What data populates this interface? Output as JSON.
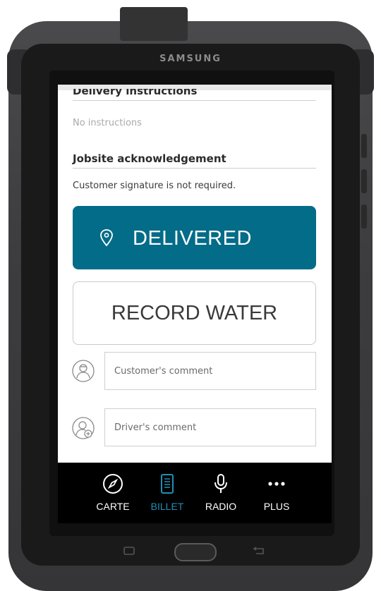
{
  "device": {
    "brand": "SAMSUNG"
  },
  "status_bar": {
    "left": "",
    "right": ""
  },
  "sections": {
    "delivery_instructions": {
      "heading": "Delivery instructions",
      "body": "No instructions"
    },
    "jobsite": {
      "heading": "Jobsite acknowledgement",
      "body": "Customer signature is not required."
    }
  },
  "actions": {
    "delivered_label": "DELIVERED",
    "record_water_label": "RECORD WATER"
  },
  "comments": {
    "customer_placeholder": "Customer's comment",
    "driver_placeholder": "Driver's comment"
  },
  "nav": {
    "items": [
      {
        "label": "CARTE",
        "icon": "compass-icon",
        "active": false
      },
      {
        "label": "BILLET",
        "icon": "ticket-icon",
        "active": true
      },
      {
        "label": "RADIO",
        "icon": "microphone-icon",
        "active": false
      },
      {
        "label": "PLUS",
        "icon": "more-dots-icon",
        "active": false
      }
    ]
  },
  "colors": {
    "primary": "#036c88",
    "active_nav": "#1f8fb8",
    "nav_bg": "#000000"
  }
}
